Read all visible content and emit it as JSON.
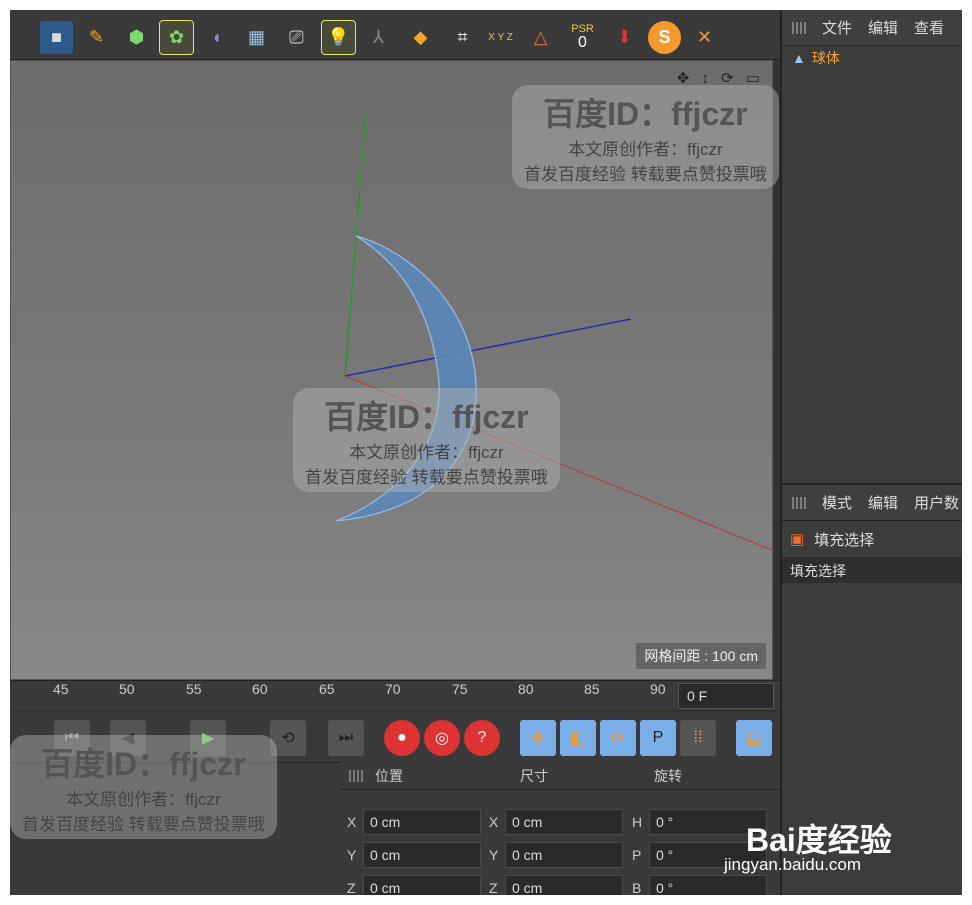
{
  "toolbar": {
    "psr_label": "PSR",
    "psr_value": "0",
    "xyz_label": "X Y Z"
  },
  "viewport": {
    "grid_label": "网格间距 : 100 cm",
    "nav_icons": "✥ ↕ ⟳ ▭"
  },
  "object_panel": {
    "menu": [
      "文件",
      "编辑",
      "查看"
    ],
    "object_name": "球体"
  },
  "attr_panel": {
    "menu": [
      "模式",
      "编辑",
      "用户数"
    ],
    "tag_name": "填充选择",
    "section": "填充选择"
  },
  "timeline": {
    "ticks": [
      "45",
      "50",
      "55",
      "60",
      "65",
      "70",
      "75",
      "80",
      "85",
      "90"
    ],
    "frame": "0 F"
  },
  "coords": {
    "headers": [
      "位置",
      "尺寸",
      "旋转"
    ],
    "rows": [
      {
        "a": "X",
        "v1": "0 cm",
        "b": "X",
        "v2": "0 cm",
        "c": "H",
        "v3": "0 °"
      },
      {
        "a": "Y",
        "v1": "0 cm",
        "b": "Y",
        "v2": "0 cm",
        "c": "P",
        "v3": "0 °"
      },
      {
        "a": "Z",
        "v1": "0 cm",
        "b": "Z",
        "v2": "0 cm",
        "c": "B",
        "v3": "0 °"
      }
    ]
  },
  "watermark": {
    "title": "百度ID：ffjczr",
    "line1": "本文原创作者：ffjczr",
    "line2": "首发百度经验 转载要点赞投票哦"
  },
  "baidu": {
    "logo": "Bai度经验",
    "url": "jingyan.baidu.com"
  }
}
